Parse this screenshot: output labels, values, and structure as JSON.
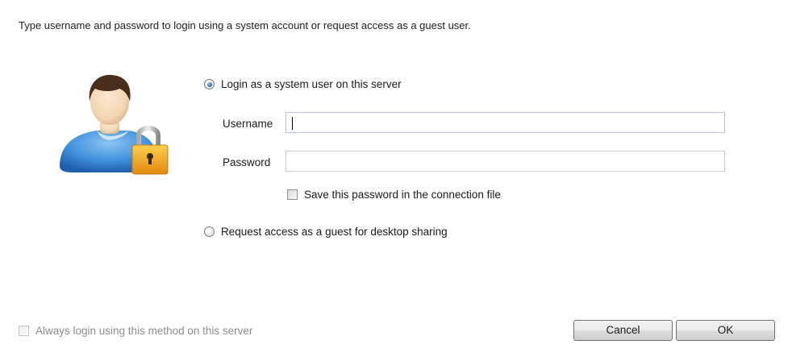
{
  "instructions": "Type username and password to login using a system account or request access as a guest user.",
  "avatar": {
    "icon": "user-lock-icon",
    "skin": "#f2d6b3",
    "hair": "#4a2e1c",
    "shirt": "#3f8fdc",
    "lock": "#f2a81d"
  },
  "options": {
    "system_user": {
      "label": "Login as a system user on this server",
      "selected": true
    },
    "guest": {
      "label": "Request access as a guest for desktop sharing",
      "selected": false
    }
  },
  "fields": {
    "username": {
      "label": "Username",
      "value": ""
    },
    "password": {
      "label": "Password",
      "value": ""
    }
  },
  "save_password": {
    "label": "Save this password in the connection file",
    "checked": false
  },
  "always_login": {
    "label": "Always login using this method on this server",
    "checked": false,
    "enabled": false
  },
  "buttons": {
    "cancel": "Cancel",
    "ok": "OK"
  }
}
